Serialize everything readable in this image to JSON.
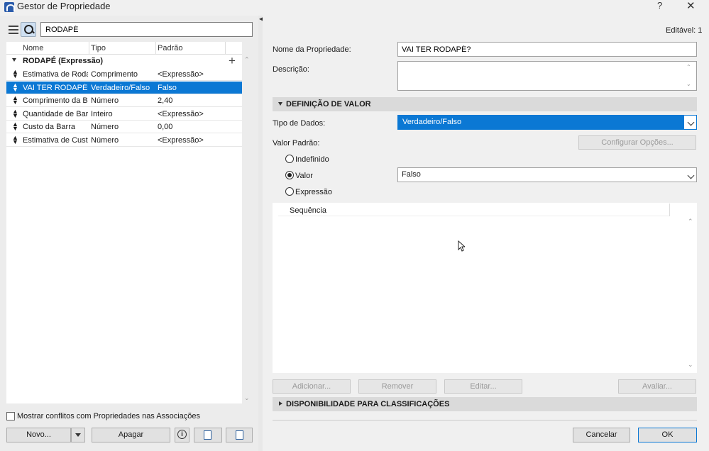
{
  "window": {
    "title": "Gestor de Propriedade",
    "help": "?",
    "close": "✕"
  },
  "search": {
    "value": "RODAPÉ"
  },
  "tree": {
    "columns": [
      "Nome",
      "Tipo",
      "Padrão"
    ],
    "group": "RODAPÉ (Expressão)",
    "add": "+",
    "rows": [
      {
        "nome": "Estimativa de Roda...",
        "tipo": "Comprimento",
        "padrao": "<Expressão>",
        "selected": false
      },
      {
        "nome": "VAI TER RODAPÉ?",
        "tipo": "Verdadeiro/Falso",
        "padrao": "Falso",
        "selected": true
      },
      {
        "nome": "Comprimento da B...",
        "tipo": "Número",
        "padrao": "2,40",
        "selected": false
      },
      {
        "nome": "Quantidade de Barr...",
        "tipo": "Inteiro",
        "padrao": "<Expressão>",
        "selected": false
      },
      {
        "nome": "Custo da Barra",
        "tipo": "Número",
        "padrao": "0,00",
        "selected": false
      },
      {
        "nome": "Estimativa de Custo",
        "tipo": "Número",
        "padrao": "<Expressão>",
        "selected": false
      }
    ]
  },
  "left_footer": {
    "conflict_label": "Mostrar conflitos com Propriedades nas Associações",
    "novo": "Novo...",
    "apagar": "Apagar",
    "info": "i"
  },
  "right": {
    "editavel": "Editável: 1",
    "nome_label": "Nome da Propriedade:",
    "nome_value": "VAI TER RODAPÉ?",
    "descricao_label": "Descrição:",
    "descricao_value": "",
    "definicao_title": "DEFINIÇÃO DE VALOR",
    "tipo_label": "Tipo de Dados:",
    "tipo_value": "Verdadeiro/Falso",
    "valor_padrao_label": "Valor Padrão:",
    "config_button": "Configurar Opções...",
    "radio": {
      "indefinido": "Indefinido",
      "valor": "Valor",
      "expressao": "Expressão",
      "selected": "valor"
    },
    "valor_value": "Falso",
    "seq_header": "Sequência",
    "buttons": {
      "adicionar": "Adicionar...",
      "remover": "Remover",
      "editar": "Editar...",
      "avaliar": "Avaliar..."
    },
    "disponibilidade_title": "DISPONIBILIDADE PARA CLASSIFICAÇÕES",
    "cancelar": "Cancelar",
    "ok": "OK"
  },
  "colors": {
    "selection": "#0b78d4",
    "background": "#f0f0f0"
  }
}
